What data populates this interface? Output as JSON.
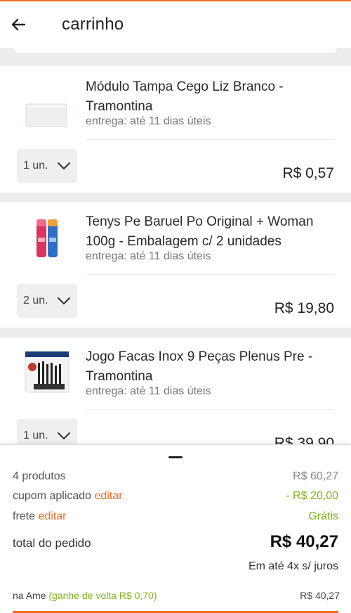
{
  "header": {
    "title": "carrinho"
  },
  "items": [
    {
      "name": "Módulo Tampa Cego Liz Branco - Tramontina",
      "delivery": "entrega: até 11 dias úteis",
      "qty": "1 un.",
      "price": "R$ 0,57"
    },
    {
      "name": "Tenys Pe Baruel Po Original + Woman 100g - Embalagem c/ 2 unidades",
      "delivery": "entrega: até 11 dias úteis",
      "qty": "2 un.",
      "price": "R$ 19,80"
    },
    {
      "name": "Jogo Facas Inox 9 Peças Plenus Pre - Tramontina",
      "delivery": "entrega: até 11 dias úteis",
      "qty": "1 un.",
      "price": "R$ 39,90"
    }
  ],
  "summary": {
    "products_label": "4 produtos",
    "products_value": "R$ 60,27",
    "coupon_label": "cupom aplicado",
    "coupon_edit": "editar",
    "coupon_value": "- R$ 20,00",
    "shipping_label": "frete",
    "shipping_edit": "editar",
    "shipping_value": "Grátis",
    "total_label": "total do pedido",
    "total_value": "R$ 40,27",
    "installments": "Em até 4x s/ juros",
    "ame_label": "na Ame",
    "ame_cashback": "(ganhe de volta R$ 0,70)",
    "ame_value": "R$ 40,27"
  },
  "colors": {
    "accent": "#f26a21",
    "green": "#7fb418"
  }
}
